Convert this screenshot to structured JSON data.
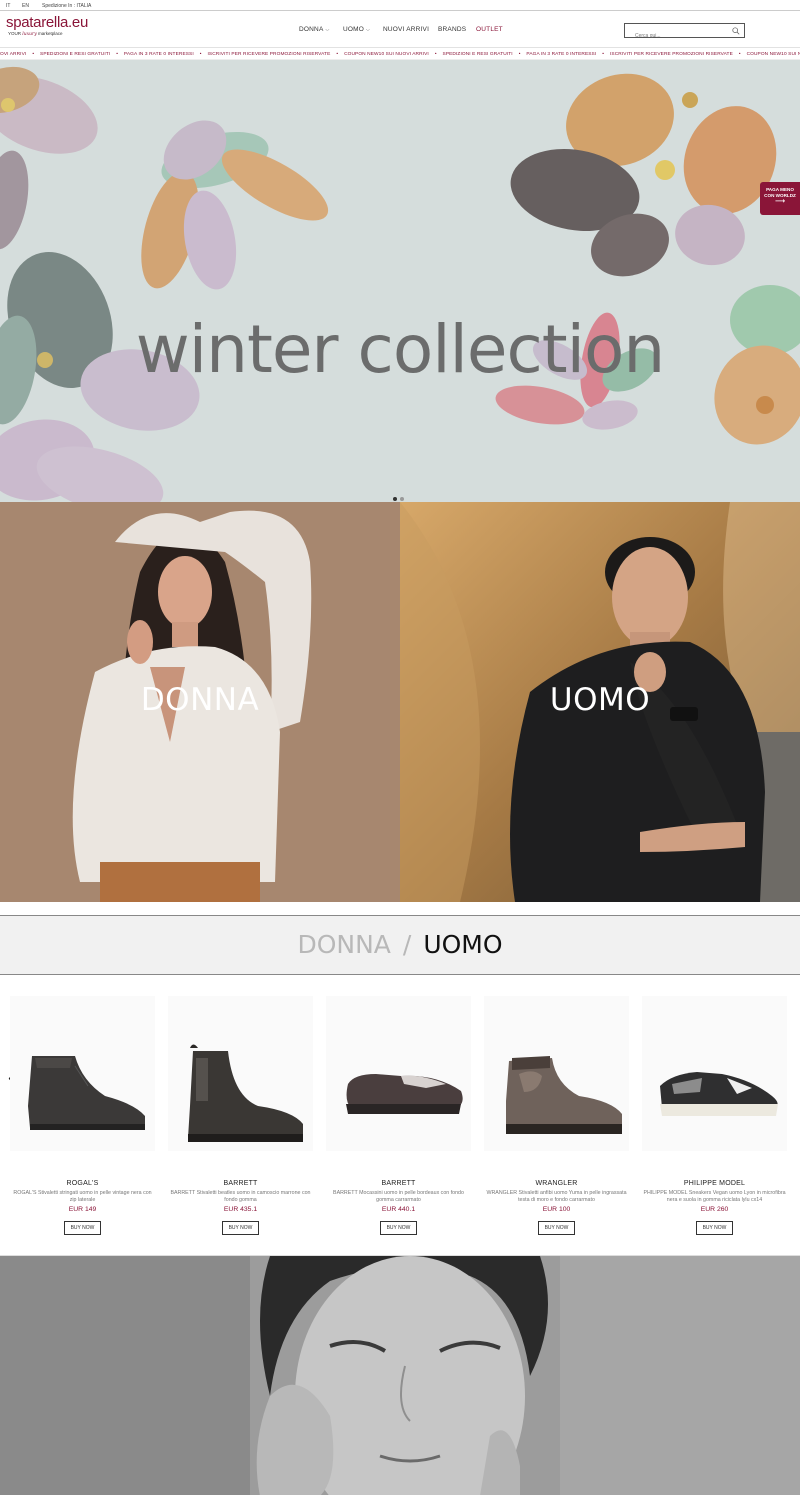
{
  "topbar": {
    "lang_it": "IT",
    "lang_en": "EN",
    "shipping": "Spedizione In : ITALIA"
  },
  "header": {
    "logo_main": "spatarella.eu",
    "logo_sub_prefix": "YOUR",
    "logo_sub_script": "luxury",
    "logo_sub_suffix": "marketplace",
    "nav": {
      "donna": "DONNA",
      "uomo": "UOMO",
      "nuovi_arrivi": "NUOVI ARRIVI",
      "brands": "BRANDS",
      "outlet": "OUTLET"
    },
    "search_placeholder": "Cerca qui..."
  },
  "marquee": {
    "items": [
      "OVI ARRIVI",
      "SPEDIZIONI E RESI GRATUITI",
      "PAGA IN 3 RATE 0 INTERESSI",
      "ISCRIVITI PER RICEVERE PROMOZIONI RISERVATE",
      "COUPON NEW10 SUI NUOVI ARRIVI",
      "SPEDIZIONI E RESI GRATUITI",
      "PAGA IN 3 RATE 0 INTERESSI",
      "ISCRIVITI PER RICEVERE PROMOZIONI RISERVATE",
      "COUPON NEW10 SUI NUOVI ARRIVI"
    ]
  },
  "hero": {
    "title": "winter collection",
    "slides": 2,
    "active_slide": 1
  },
  "badge": {
    "line1": "PAGA MENO",
    "line2": "CON WORLDZ"
  },
  "tiles": {
    "donna": "DONNA",
    "uomo": "UOMO"
  },
  "tabs": {
    "donna": "DONNA",
    "separator": "/",
    "uomo": "UOMO"
  },
  "products": [
    {
      "brand": "ROGAL'S",
      "desc": "ROGAL'S Stivaletti stringati uomo in pelle vintage nera con zip laterale",
      "price": "EUR 149",
      "button": "BUY NOW"
    },
    {
      "brand": "BARRETT",
      "desc": "BARRETT Stivaletti beatles uomo in camoscio marrone con fondo gomma",
      "price": "EUR 435.1",
      "button": "BUY NOW"
    },
    {
      "brand": "BARRETT",
      "desc": "BARRETT Mocassini uomo in pelle bordeaux con fondo gomma carrarmato",
      "price": "EUR 440.1",
      "button": "BUY NOW"
    },
    {
      "brand": "WRANGLER",
      "desc": "WRANGLER Stivaletti anfibi uomo Yuma in pelle ingrassata testa di moro e fondo carrarmato",
      "price": "EUR 100",
      "button": "BUY NOW"
    },
    {
      "brand": "PHILIPPE MODEL",
      "desc": "PHILIPPE MODEL Sneakers Vegan uomo Lyon in microfibra nera e suola in gomma riciclata lylu cx14",
      "price": "EUR 260",
      "button": "BUY NOW"
    }
  ],
  "colors": {
    "brand": "#8a1538",
    "hero_bg": "#d4dcdc",
    "tab_inactive": "#b8b8b8",
    "tab_active": "#111111"
  }
}
